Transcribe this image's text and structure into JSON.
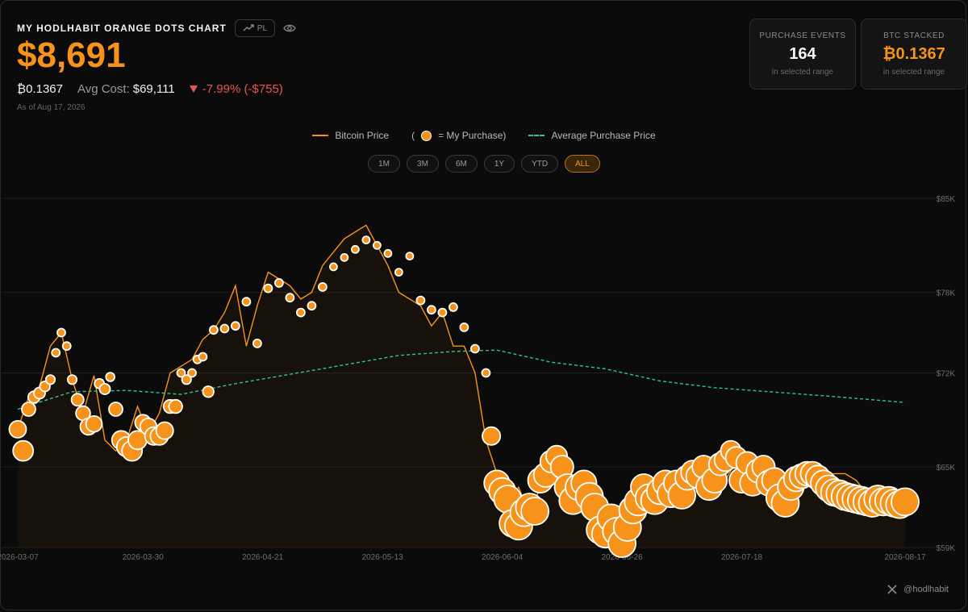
{
  "header": {
    "title": "MY HODLHABIT ORANGE DOTS CHART",
    "pl_label": "PL",
    "value": "$8,691",
    "btc_amount": "₿0.1367",
    "avg_cost_label": "Avg Cost:",
    "avg_cost_value": "$69,111",
    "change": "-7.99% (-$755)",
    "as_of": "As of Aug 17, 2026"
  },
  "cards": {
    "purchase_events": {
      "label": "PURCHASE EVENTS",
      "value": "164",
      "sub": "in selected range"
    },
    "btc_stacked": {
      "label": "BTC STACKED",
      "value": "₿0.1367",
      "sub": "in selected range"
    }
  },
  "legend": {
    "price": "Bitcoin Price",
    "purchase_open": "(",
    "purchase_close": "= My Purchase)",
    "avg": "Average Purchase Price"
  },
  "ranges": [
    "1M",
    "3M",
    "6M",
    "1Y",
    "YTD",
    "ALL"
  ],
  "active_range": "ALL",
  "footer": {
    "handle": "@hodlhabit"
  },
  "colors": {
    "accent": "#f7931a",
    "avg_line": "#2ec39a",
    "negative": "#e8554e",
    "background": "#0b0b0b"
  },
  "chart_data": {
    "type": "line",
    "x_start": "2026-03-07",
    "x_end": "2026-08-17",
    "xticks": [
      "2026-03-07",
      "2026-03-30",
      "2026-04-21",
      "2026-05-13",
      "2026-06-04",
      "2026-06-26",
      "2026-07-18",
      "2026-08-17"
    ],
    "yticks": [
      59000,
      65000,
      72000,
      78000,
      85000
    ],
    "ytick_labels": [
      "$59K",
      "$65K",
      "$72K",
      "$78K",
      "$85K"
    ],
    "ylim": [
      59000,
      85000
    ],
    "series": [
      {
        "name": "Bitcoin Price",
        "x": [
          "2026-03-07",
          "2026-03-09",
          "2026-03-11",
          "2026-03-13",
          "2026-03-15",
          "2026-03-17",
          "2026-03-19",
          "2026-03-21",
          "2026-03-23",
          "2026-03-25",
          "2026-03-27",
          "2026-03-29",
          "2026-03-31",
          "2026-04-02",
          "2026-04-04",
          "2026-04-06",
          "2026-04-08",
          "2026-04-10",
          "2026-04-12",
          "2026-04-14",
          "2026-04-16",
          "2026-04-18",
          "2026-04-20",
          "2026-04-22",
          "2026-04-24",
          "2026-04-26",
          "2026-04-28",
          "2026-04-30",
          "2026-05-02",
          "2026-05-04",
          "2026-05-06",
          "2026-05-08",
          "2026-05-10",
          "2026-05-12",
          "2026-05-14",
          "2026-05-16",
          "2026-05-18",
          "2026-05-20",
          "2026-05-22",
          "2026-05-24",
          "2026-05-26",
          "2026-05-28",
          "2026-05-30",
          "2026-06-01",
          "2026-06-03",
          "2026-06-05",
          "2026-06-07",
          "2026-06-09",
          "2026-06-11",
          "2026-06-13",
          "2026-06-15",
          "2026-06-17",
          "2026-06-19",
          "2026-06-21",
          "2026-06-23",
          "2026-06-25",
          "2026-06-27",
          "2026-06-29",
          "2026-07-01",
          "2026-07-03",
          "2026-07-05",
          "2026-07-07",
          "2026-07-09",
          "2026-07-11",
          "2026-07-13",
          "2026-07-15",
          "2026-07-17",
          "2026-07-19",
          "2026-07-21",
          "2026-07-23",
          "2026-07-25",
          "2026-07-27",
          "2026-07-29",
          "2026-07-31",
          "2026-08-02",
          "2026-08-04",
          "2026-08-06",
          "2026-08-08",
          "2026-08-10",
          "2026-08-12",
          "2026-08-14",
          "2026-08-16",
          "2026-08-17"
        ],
        "values": [
          67800,
          70200,
          71000,
          74000,
          75000,
          71500,
          69000,
          71800,
          67000,
          66200,
          67000,
          69500,
          67500,
          69000,
          72000,
          72500,
          73000,
          74500,
          75200,
          76500,
          78500,
          74000,
          77000,
          79500,
          79000,
          78500,
          77500,
          78000,
          80000,
          81000,
          82000,
          82500,
          83000,
          81500,
          80000,
          78000,
          77500,
          77000,
          75500,
          76500,
          74000,
          74000,
          72000,
          67000,
          64500,
          62000,
          63500,
          61500,
          63500,
          65000,
          64500,
          63000,
          64000,
          62000,
          60500,
          60000,
          61000,
          63500,
          64000,
          63000,
          64500,
          63500,
          64500,
          65000,
          65500,
          64000,
          65500,
          66000,
          65000,
          65500,
          64500,
          64500,
          63500,
          64000,
          64000,
          64500,
          64500,
          64000,
          63000,
          63500,
          63000,
          63000,
          62800
        ]
      },
      {
        "name": "Average Purchase Price",
        "x": [
          "2026-03-07",
          "2026-03-17",
          "2026-03-27",
          "2026-04-06",
          "2026-04-16",
          "2026-04-26",
          "2026-05-06",
          "2026-05-16",
          "2026-05-26",
          "2026-06-03",
          "2026-06-13",
          "2026-06-23",
          "2026-07-03",
          "2026-07-13",
          "2026-07-23",
          "2026-08-02",
          "2026-08-17"
        ],
        "values": [
          69300,
          70600,
          70700,
          70400,
          71200,
          71900,
          72600,
          73300,
          73600,
          73700,
          72800,
          72300,
          71400,
          70900,
          70600,
          70300,
          69800
        ]
      }
    ],
    "purchase_markers": {
      "name": "My Purchase",
      "x": [
        "2026-03-07",
        "2026-03-08",
        "2026-03-09",
        "2026-03-10",
        "2026-03-11",
        "2026-03-12",
        "2026-03-13",
        "2026-03-14",
        "2026-03-15",
        "2026-03-16",
        "2026-03-17",
        "2026-03-18",
        "2026-03-19",
        "2026-03-20",
        "2026-03-21",
        "2026-03-22",
        "2026-03-23",
        "2026-03-24",
        "2026-03-25",
        "2026-03-26",
        "2026-03-27",
        "2026-03-28",
        "2026-03-29",
        "2026-03-30",
        "2026-03-31",
        "2026-04-01",
        "2026-04-02",
        "2026-04-03",
        "2026-04-04",
        "2026-04-05",
        "2026-04-06",
        "2026-04-07",
        "2026-04-08",
        "2026-04-09",
        "2026-04-10",
        "2026-04-11",
        "2026-04-12",
        "2026-04-14",
        "2026-04-16",
        "2026-04-18",
        "2026-04-20",
        "2026-04-22",
        "2026-04-24",
        "2026-04-26",
        "2026-04-28",
        "2026-04-30",
        "2026-05-02",
        "2026-05-04",
        "2026-05-06",
        "2026-05-08",
        "2026-05-10",
        "2026-05-12",
        "2026-05-14",
        "2026-05-16",
        "2026-05-18",
        "2026-05-20",
        "2026-05-22",
        "2026-05-24",
        "2026-05-26",
        "2026-05-28",
        "2026-05-30",
        "2026-06-01",
        "2026-06-02",
        "2026-06-03",
        "2026-06-04",
        "2026-06-05",
        "2026-06-06",
        "2026-06-07",
        "2026-06-08",
        "2026-06-09",
        "2026-06-10",
        "2026-06-11",
        "2026-06-12",
        "2026-06-13",
        "2026-06-14",
        "2026-06-15",
        "2026-06-16",
        "2026-06-17",
        "2026-06-18",
        "2026-06-19",
        "2026-06-20",
        "2026-06-21",
        "2026-06-22",
        "2026-06-23",
        "2026-06-24",
        "2026-06-25",
        "2026-06-26",
        "2026-06-27",
        "2026-06-28",
        "2026-06-29",
        "2026-06-30",
        "2026-07-01",
        "2026-07-02",
        "2026-07-03",
        "2026-07-04",
        "2026-07-05",
        "2026-07-06",
        "2026-07-07",
        "2026-07-08",
        "2026-07-09",
        "2026-07-10",
        "2026-07-11",
        "2026-07-12",
        "2026-07-13",
        "2026-07-14",
        "2026-07-15",
        "2026-07-16",
        "2026-07-17",
        "2026-07-18",
        "2026-07-19",
        "2026-07-20",
        "2026-07-21",
        "2026-07-22",
        "2026-07-23",
        "2026-07-24",
        "2026-07-25",
        "2026-07-26",
        "2026-07-27",
        "2026-07-28",
        "2026-07-29",
        "2026-07-30",
        "2026-07-31",
        "2026-08-01",
        "2026-08-02",
        "2026-08-03",
        "2026-08-04",
        "2026-08-05",
        "2026-08-06",
        "2026-08-07",
        "2026-08-08",
        "2026-08-09",
        "2026-08-10",
        "2026-08-11",
        "2026-08-12",
        "2026-08-13",
        "2026-08-14",
        "2026-08-15",
        "2026-08-16",
        "2026-08-17"
      ],
      "values": [
        67800,
        66200,
        69300,
        70200,
        70500,
        71000,
        71500,
        73500,
        75000,
        74000,
        71500,
        70000,
        69000,
        68000,
        68200,
        71200,
        70800,
        71700,
        69300,
        67000,
        66500,
        66200,
        67000,
        68300,
        68000,
        67300,
        67300,
        67700,
        69500,
        69500,
        72000,
        71500,
        72000,
        73000,
        73200,
        70600,
        75200,
        75300,
        75500,
        77300,
        74200,
        78300,
        78700,
        77600,
        76500,
        77000,
        78400,
        79900,
        80600,
        81200,
        81900,
        81500,
        80900,
        79500,
        80700,
        77400,
        76700,
        76500,
        76900,
        75400,
        73800,
        72000,
        67300,
        63800,
        63200,
        62600,
        60800,
        60600,
        61600,
        62000,
        61700,
        64000,
        64400,
        65400,
        65800,
        65000,
        63500,
        62500,
        63500,
        63800,
        62800,
        62000,
        60300,
        60000,
        61200,
        60200,
        59300,
        60500,
        61800,
        62400,
        63500,
        62700,
        62500,
        63200,
        63800,
        63000,
        63800,
        62900,
        64200,
        64600,
        64300,
        65000,
        63500,
        64000,
        65200,
        65500,
        66200,
        65700,
        64000,
        65300,
        63800,
        64700,
        65000,
        63800,
        64000,
        62700,
        62300,
        63500,
        64100,
        64300,
        64500,
        64500,
        64200,
        63800,
        63400,
        63100,
        63000,
        62800,
        62700,
        62600,
        62500,
        62400,
        62300,
        62600,
        62400,
        62500,
        62300,
        62200,
        62400
      ]
    }
  }
}
